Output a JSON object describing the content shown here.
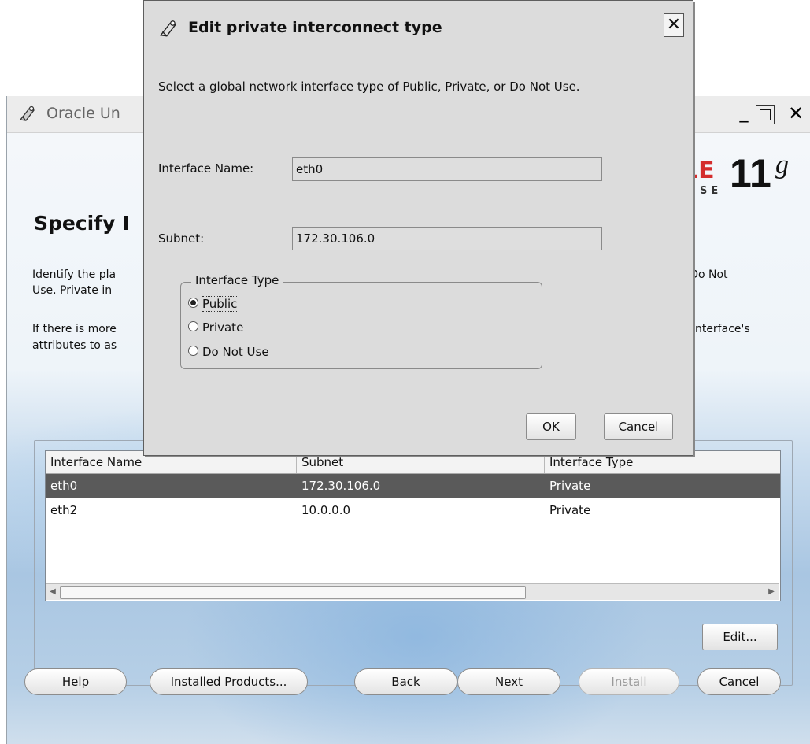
{
  "installer": {
    "title": "Oracle Un",
    "heading": "Specify I",
    "desc_left": [
      "Identify the pla",
      "Use.  Private in",
      "If there is more",
      "attributes to as"
    ],
    "desc_right": [
      "r Do Not",
      "e interface's"
    ],
    "brand": {
      "red_text": "LE",
      "edition_text": "SE",
      "version": "11",
      "suffix": "g",
      "accent_color": "#d42d2d"
    },
    "table": {
      "columns": [
        "Interface Name",
        "Subnet",
        "Interface Type"
      ],
      "rows": [
        {
          "name": "eth0",
          "subnet": "172.30.106.0",
          "type": "Private",
          "selected": true
        },
        {
          "name": "eth2",
          "subnet": "10.0.0.0",
          "type": "Private",
          "selected": false
        }
      ]
    },
    "edit_button": "Edit...",
    "footer": {
      "help": "Help",
      "installed_products": "Installed Products...",
      "back": "Back",
      "next": "Next",
      "install": "Install",
      "cancel": "Cancel"
    }
  },
  "dialog": {
    "title": "Edit private interconnect type",
    "instruction": "Select a global network interface type of Public, Private, or Do Not Use.",
    "interface_name_label": "Interface Name:",
    "interface_name_value": "eth0",
    "subnet_label": "Subnet:",
    "subnet_value": "172.30.106.0",
    "interface_type_legend": "Interface Type",
    "options": [
      "Public",
      "Private",
      "Do Not Use"
    ],
    "selected_option": "Public",
    "ok": "OK",
    "cancel": "Cancel"
  }
}
